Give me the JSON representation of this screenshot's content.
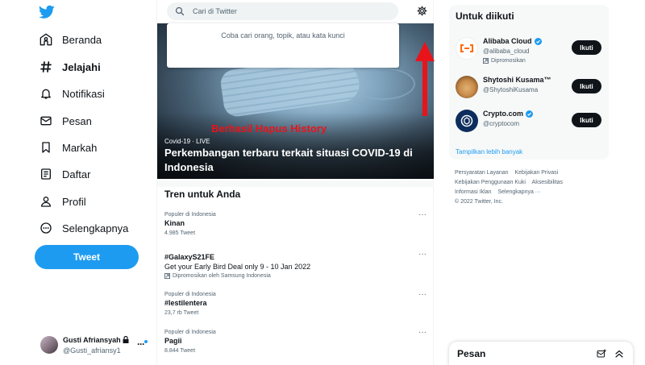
{
  "colors": {
    "accent": "#1d9bf0",
    "annotation": "#e8141b",
    "text": "#0f1419",
    "muted": "#536471"
  },
  "sidebar": {
    "logo_icon": "twitter-bird-icon",
    "items": [
      {
        "label": "Beranda",
        "icon": "home-icon"
      },
      {
        "label": "Jelajahi",
        "icon": "hashtag-icon"
      },
      {
        "label": "Notifikasi",
        "icon": "bell-icon"
      },
      {
        "label": "Pesan",
        "icon": "envelope-icon"
      },
      {
        "label": "Markah",
        "icon": "bookmark-icon"
      },
      {
        "label": "Daftar",
        "icon": "list-icon"
      },
      {
        "label": "Profil",
        "icon": "person-icon"
      },
      {
        "label": "Selengkapnya",
        "icon": "more-circle-icon"
      }
    ],
    "tweet_label": "Tweet",
    "profile": {
      "name": "Gusti Afriansyah",
      "handle": "@Gusti_afriansy1",
      "more": "···"
    }
  },
  "search": {
    "placeholder": "Cari di Twitter",
    "empty_message": "Coba cari orang, topik, atau kata kunci"
  },
  "annotation": {
    "text": "Berhasil Hapus History"
  },
  "hero": {
    "category": "Covid-19 · LIVE",
    "title": "Perkembangan terbaru terkait situasi COVID-19 di Indonesia"
  },
  "trends": {
    "heading": "Tren untuk Anda",
    "items": [
      {
        "context": "Populer di Indonesia",
        "name": "Kinan",
        "count": "4.985 Tweet",
        "more": "···"
      },
      {
        "name": "#GalaxyS21FE",
        "description": "Get your Early Bird Deal only 9 - 10 Jan 2022",
        "promoted": "Dipromosikan oleh Samsung Indonesia",
        "more": "···"
      },
      {
        "context": "Populer di Indonesia",
        "name": "#lestilentera",
        "count": "23,7 rb Tweet",
        "more": "···"
      },
      {
        "context": "Populer di Indonesia",
        "name": "Pagii",
        "count": "8.844 Tweet",
        "more": "···"
      }
    ]
  },
  "who_to_follow": {
    "title": "Untuk diikuti",
    "items": [
      {
        "name": "Alibaba Cloud",
        "handle": "@alibaba_cloud",
        "promoted": "Dipromosikan",
        "button": "Ikuti",
        "verified": true
      },
      {
        "name": "Shytoshi Kusama™",
        "handle": "@ShytoshiKusama",
        "button": "Ikuti",
        "verified": false
      },
      {
        "name": "Crypto.com",
        "handle": "@cryptocom",
        "button": "Ikuti",
        "verified": true
      }
    ],
    "show_more": "Tampilkan lebih banyak"
  },
  "footer": {
    "links": [
      "Persyaratan Layanan",
      "Kebijakan Privasi",
      "Kebijakan Penggunaan Kuki",
      "Aksesibilitas",
      "Informasi Iklan",
      "Selengkapnya ···"
    ],
    "copyright": "© 2022 Twitter, Inc."
  },
  "messages_bar": {
    "title": "Pesan"
  }
}
